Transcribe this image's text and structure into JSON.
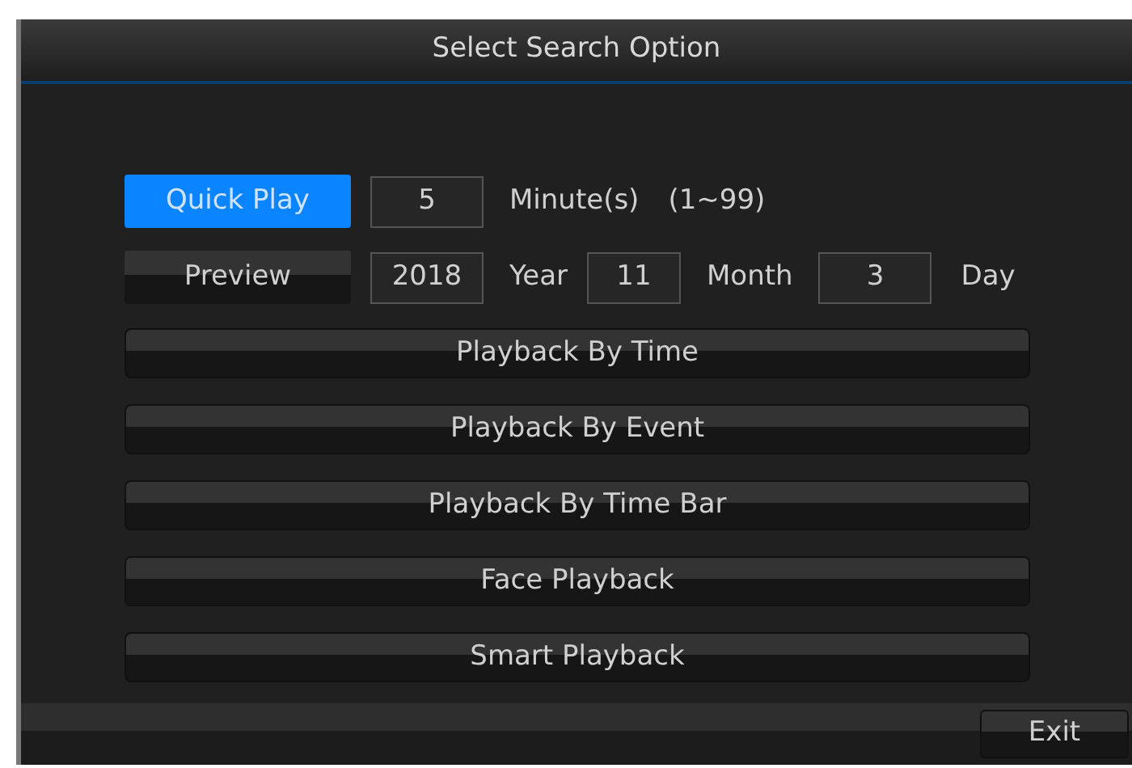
{
  "window": {
    "title": "Select Search Option"
  },
  "quick_play": {
    "label": "Quick Play",
    "selected": true,
    "value": "5",
    "unit": "Minute(s)",
    "range": "(1~99)"
  },
  "preview": {
    "label": "Preview",
    "selected": false,
    "year": "2018",
    "year_label": "Year",
    "month": "11",
    "month_label": "Month",
    "day": "3",
    "day_label": "Day"
  },
  "options": [
    "Playback By Time",
    "Playback By Event",
    "Playback By Time Bar",
    "Face Playback",
    "Smart Playback"
  ],
  "buttons": [
    "Exit"
  ]
}
